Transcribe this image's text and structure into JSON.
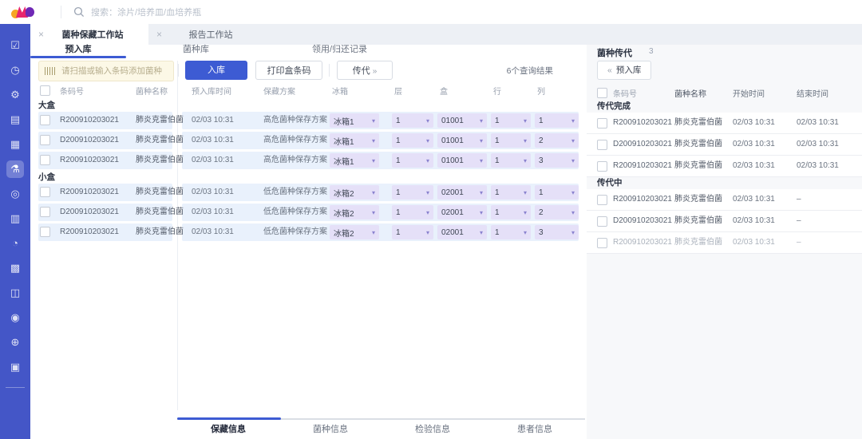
{
  "colors": {
    "accent": "#3D5BD3",
    "sidebar": "#4456C7",
    "select_bg": "#E5E0F8",
    "row_bg": "#E9F1FC",
    "scan_input_bg": "#FCF8E6"
  },
  "header": {
    "search_placeholder": "搜索：涂片/培养皿/血培养瓶"
  },
  "window_tabs": [
    {
      "label": "菌种保藏工作站"
    },
    {
      "label": "报告工作站"
    }
  ],
  "sub_tabs": [
    {
      "label": "预入库"
    },
    {
      "label": "菌种库"
    },
    {
      "label": "领用/归还记录"
    }
  ],
  "toolbar": {
    "scan_placeholder": "请扫描或输入条码添加菌种",
    "store_label": "入库",
    "print_label": "打印盒条码",
    "passage_label": "传代",
    "passage_arrow": "»",
    "result_count": "6个查询结果"
  },
  "table": {
    "headers": {
      "barcode": "条码号",
      "name": "菌种名称",
      "time": "预入库时间",
      "plan": "保藏方案",
      "fridge": "冰箱",
      "layer": "层",
      "box": "盒",
      "row": "行",
      "col": "列"
    },
    "groups": [
      {
        "label": "大盒",
        "rows": [
          {
            "barcode": "R200910203021",
            "name": "肺炎克雷伯菌",
            "time": "02/03 10:31",
            "plan": "高危菌种保存方案",
            "fridge": "冰箱1",
            "layer": "1",
            "box": "01001",
            "row": "1",
            "col": "1"
          },
          {
            "barcode": "D200910203021",
            "name": "肺炎克雷伯菌",
            "time": "02/03 10:31",
            "plan": "高危菌种保存方案",
            "fridge": "冰箱1",
            "layer": "1",
            "box": "01001",
            "row": "1",
            "col": "2"
          },
          {
            "barcode": "R200910203021",
            "name": "肺炎克雷伯菌",
            "time": "02/03 10:31",
            "plan": "高危菌种保存方案",
            "fridge": "冰箱1",
            "layer": "1",
            "box": "01001",
            "row": "1",
            "col": "3"
          }
        ]
      },
      {
        "label": "小盒",
        "rows": [
          {
            "barcode": "R200910203021",
            "name": "肺炎克雷伯菌",
            "time": "02/03 10:31",
            "plan": "低危菌种保存方案",
            "fridge": "冰箱2",
            "layer": "1",
            "box": "02001",
            "row": "1",
            "col": "1"
          },
          {
            "barcode": "D200910203021",
            "name": "肺炎克雷伯菌",
            "time": "02/03 10:31",
            "plan": "低危菌种保存方案",
            "fridge": "冰箱2",
            "layer": "1",
            "box": "02001",
            "row": "1",
            "col": "2"
          },
          {
            "barcode": "R200910203021",
            "name": "肺炎克雷伯菌",
            "time": "02/03 10:31",
            "plan": "低危菌种保存方案",
            "fridge": "冰箱2",
            "layer": "1",
            "box": "02001",
            "row": "1",
            "col": "3"
          }
        ]
      }
    ]
  },
  "bottom_tabs": [
    {
      "label": "保藏信息"
    },
    {
      "label": "菌种信息"
    },
    {
      "label": "检验信息"
    },
    {
      "label": "患者信息"
    }
  ],
  "right_panel": {
    "title": "菌种传代",
    "count": "3",
    "back_arrow": "«",
    "back_label": "预入库",
    "headers": {
      "barcode": "条码号",
      "name": "菌种名称",
      "start": "开始时间",
      "end": "结束时间"
    },
    "groups": [
      {
        "label": "传代完成",
        "rows": [
          {
            "barcode": "R200910203021",
            "name": "肺炎克雷伯菌",
            "start": "02/03 10:31",
            "end": "02/03 10:31"
          },
          {
            "barcode": "D200910203021",
            "name": "肺炎克雷伯菌",
            "start": "02/03 10:31",
            "end": "02/03 10:31"
          },
          {
            "barcode": "R200910203021",
            "name": "肺炎克雷伯菌",
            "start": "02/03 10:31",
            "end": "02/03 10:31"
          }
        ]
      },
      {
        "label": "传代中",
        "rows": [
          {
            "barcode": "R200910203021",
            "name": "肺炎克雷伯菌",
            "start": "02/03 10:31",
            "end": "–"
          },
          {
            "barcode": "D200910203021",
            "name": "肺炎克雷伯菌",
            "start": "02/03 10:31",
            "end": "–"
          },
          {
            "barcode": "R200910203021",
            "name": "肺炎克雷伯菌",
            "start": "02/03 10:31",
            "end": "–"
          }
        ]
      }
    ]
  },
  "sidebar": {
    "icons": [
      {
        "name": "task-icon",
        "glyph": "☑"
      },
      {
        "name": "clock-icon",
        "glyph": "◷"
      },
      {
        "name": "machine-icon",
        "glyph": "⚙"
      },
      {
        "name": "image-icon",
        "glyph": "▤"
      },
      {
        "name": "card-icon",
        "glyph": "▦"
      },
      {
        "name": "flask-icon",
        "glyph": "⚗"
      },
      {
        "name": "compass-icon",
        "glyph": "◎"
      },
      {
        "name": "document-icon",
        "glyph": "▥"
      },
      {
        "name": "timer-icon",
        "glyph": "◔"
      },
      {
        "name": "barcode-icon",
        "glyph": "▩"
      },
      {
        "name": "user-chart-icon",
        "glyph": "◫"
      },
      {
        "name": "headset-icon",
        "glyph": "◉"
      },
      {
        "name": "vehicle-icon",
        "glyph": "⊕"
      },
      {
        "name": "report-icon",
        "glyph": "▣"
      }
    ]
  },
  "ui": {
    "close_glyph": "×",
    "caret_glyph": "▾"
  }
}
